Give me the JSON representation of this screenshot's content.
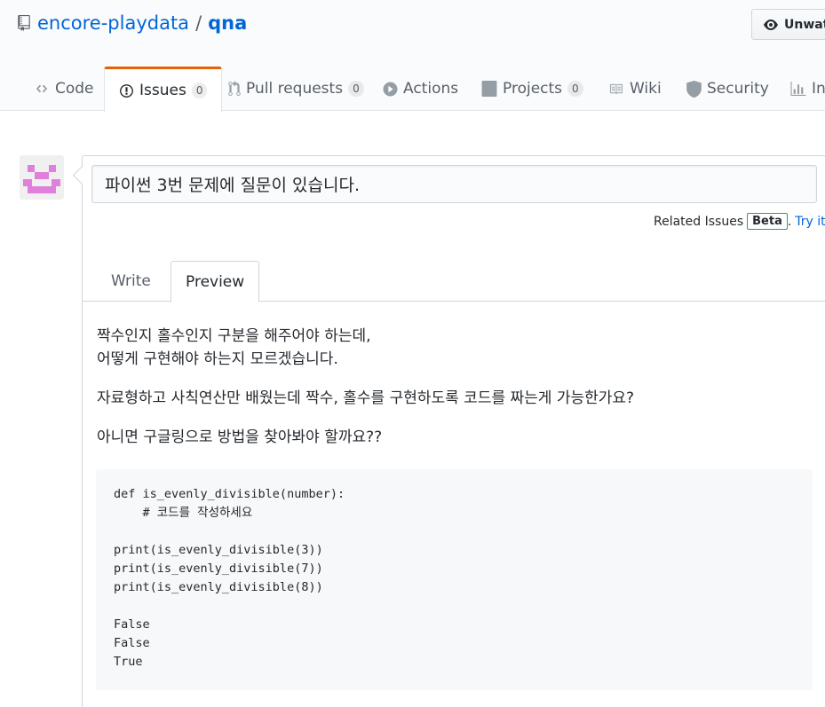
{
  "repo": {
    "owner": "encore-playdata",
    "separator": "/",
    "name": "qna",
    "watch_label": "Unwatch"
  },
  "tabs": [
    {
      "label": "Code",
      "icon": "code-icon"
    },
    {
      "label": "Issues",
      "icon": "issue-opened-icon",
      "count": "0",
      "selected": true
    },
    {
      "label": "Pull requests",
      "icon": "git-pull-request-icon",
      "count": "0"
    },
    {
      "label": "Actions",
      "icon": "play-icon"
    },
    {
      "label": "Projects",
      "icon": "project-icon",
      "count": "0"
    },
    {
      "label": "Wiki",
      "icon": "book-icon"
    },
    {
      "label": "Security",
      "icon": "shield-icon"
    },
    {
      "label": "In",
      "icon": "graph-icon"
    }
  ],
  "issue": {
    "title_value": "파이썬 3번 문제에 질문이 있습니다.",
    "related_label": "Related Issues",
    "beta_label": "Beta",
    "period": ".",
    "try_it_label": "Try it."
  },
  "editor": {
    "write_label": "Write",
    "preview_label": "Preview"
  },
  "preview": {
    "para1_line1": "짝수인지 홀수인지 구분을 해주어야 하는데,",
    "para1_line2": "어떻게 구현해야 하는지 모르겠습니다.",
    "para2": "자료형하고 사칙연산만 배웠는데 짝수, 홀수를 구현하도록 코드를 짜는게 가능한가요?",
    "para3": "아니면 구글링으로 방법을 찾아봐야 할까요??",
    "code": "def is_evenly_divisible(number):\n    # 코드를 작성하세요\n\nprint(is_evenly_divisible(3))\nprint(is_evenly_divisible(7))\nprint(is_evenly_divisible(8))\n\nFalse\nFalse\nTrue"
  },
  "colors": {
    "link": "#0366d6",
    "selected_tab_border": "#e36209",
    "beta_border": "#28a745",
    "avatar": "#e07fdc"
  }
}
